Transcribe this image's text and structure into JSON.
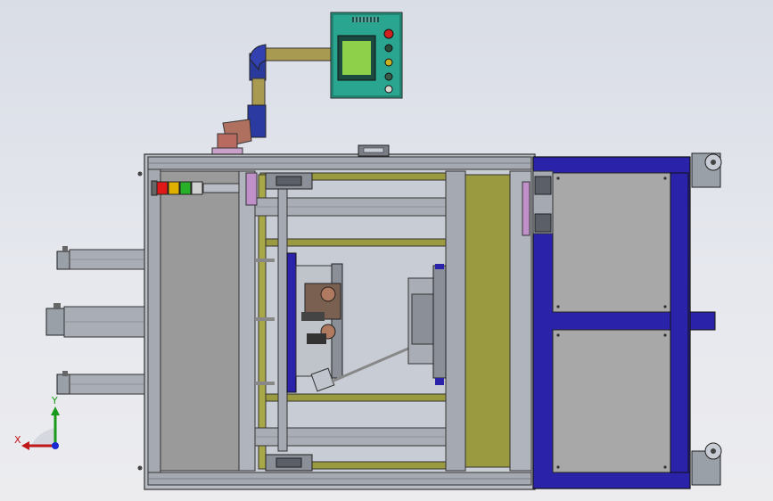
{
  "triad": {
    "x_label": "X",
    "y_label": "Y",
    "x_color": "#c01818",
    "y_color": "#1a9a1a",
    "z_color": "#1a2ad0"
  },
  "control_panel": {
    "screen_color": "#8fd04a",
    "body_color": "#2aa590",
    "button_colors": [
      "#d02020",
      "#2a4a3a",
      "#c8b020",
      "#3a5a4a",
      "#d8d8d0"
    ]
  },
  "signal_tower": {
    "light_colors": [
      "#e01818",
      "#e0b000",
      "#28b028",
      "#d0d0d0"
    ]
  },
  "colors": {
    "frame_blue": "#2a22a8",
    "frame_grey": "#9ea4ae",
    "rail_olive": "#9a9a40",
    "panel_grey": "#a8a8a8"
  }
}
